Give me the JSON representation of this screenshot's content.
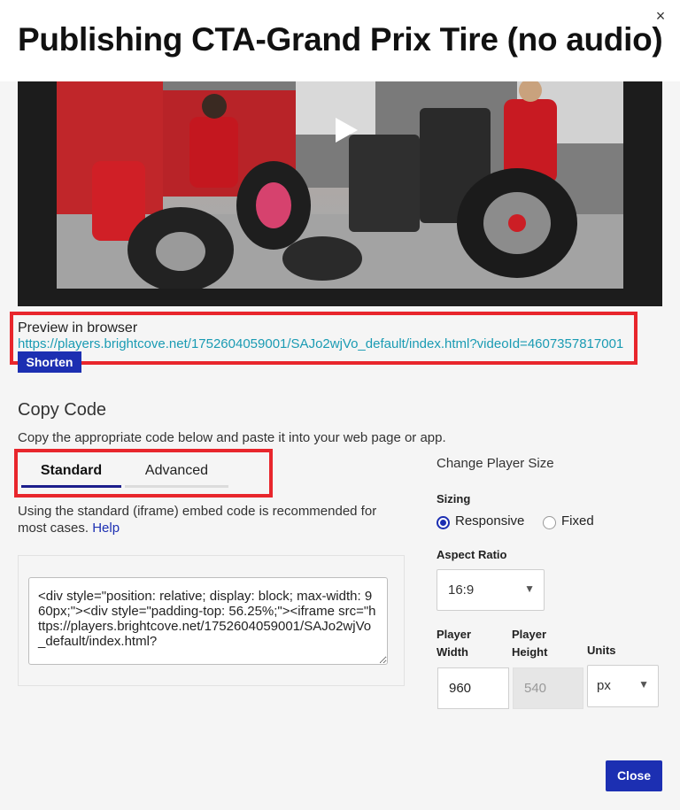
{
  "header": {
    "title": "Publishing CTA-Grand Prix Tire (no audio)",
    "close_icon": "×"
  },
  "video": {
    "play_icon": "play-icon"
  },
  "preview": {
    "label": "Preview in browser",
    "url": "https://players.brightcove.net/1752604059001/SAJo2wjVo_default/index.html?videoId=4607357817001",
    "shorten_label": "Shorten"
  },
  "copy_code": {
    "title": "Copy Code",
    "description": "Copy the appropriate code below and paste it into your web page or app.",
    "tabs": [
      {
        "label": "Standard",
        "active": true
      },
      {
        "label": "Advanced",
        "active": false
      }
    ],
    "standard_description": "Using the standard (iframe) embed code is recommended for most cases.",
    "help_label": "Help",
    "code": "<div style=\"position: relative; display: block; max-width: 960px;\"><div style=\"padding-top: 56.25%;\"><iframe src=\"https://players.brightcove.net/1752604059001/SAJo2wjVo_default/index.html?"
  },
  "player_size": {
    "title": "Change Player Size",
    "sizing_label": "Sizing",
    "sizing_options": [
      "Responsive",
      "Fixed"
    ],
    "sizing_selected": "Responsive",
    "aspect_ratio_label": "Aspect Ratio",
    "aspect_ratio_value": "16:9",
    "player_width_label": "Player Width",
    "player_width_value": "960",
    "player_height_label": "Player Height",
    "player_height_value": "540",
    "units_label": "Units",
    "units_value": "px"
  },
  "footer": {
    "close_label": "Close"
  },
  "colors": {
    "accent_blue": "#1c2fb2",
    "link_teal": "#1a9bb3",
    "highlight_red": "#e8262c"
  }
}
